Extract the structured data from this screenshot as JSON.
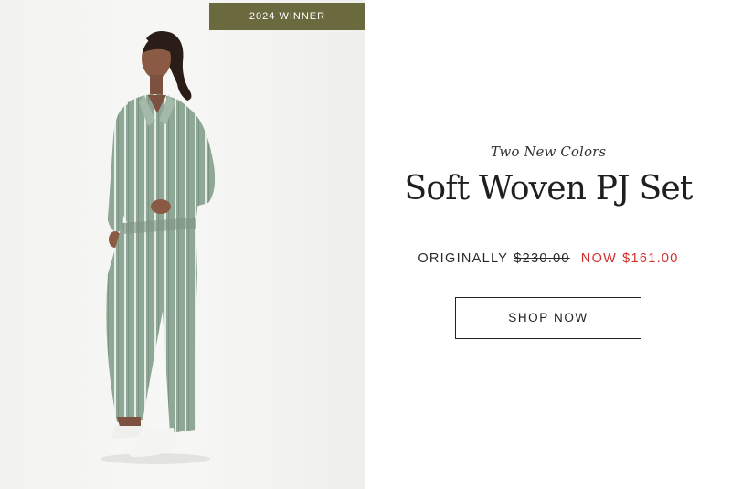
{
  "badge": {
    "label": "2024 WINNER"
  },
  "product": {
    "eyebrow": "Two New Colors",
    "title": "Soft Woven PJ Set",
    "original_label": "ORIGINALLY",
    "original_price": "$230.00",
    "now_label": "NOW",
    "now_price": "$161.00"
  },
  "cta": {
    "label": "SHOP NOW"
  },
  "colors": {
    "badge_bg": "#6b6a3f",
    "sale_red": "#d0312d",
    "pajama_green": "#8fa796"
  }
}
